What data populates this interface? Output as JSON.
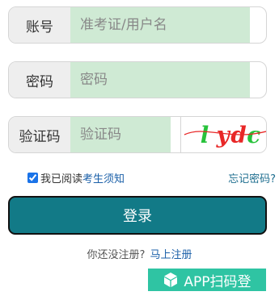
{
  "account": {
    "label": "账号",
    "placeholder": "准考证/用户名"
  },
  "password": {
    "label": "密码",
    "placeholder": "密码"
  },
  "captcha": {
    "label": "验证码",
    "placeholder": "验证码",
    "image_text": "lydc"
  },
  "agree": {
    "checked": true,
    "prefix": "我已阅读",
    "link": "考生须知"
  },
  "forgot_label": "忘记密码?",
  "login_label": "登录",
  "register": {
    "prompt": "你还没注册?",
    "link": "马上注册"
  },
  "app_scan_label": "APP扫码登",
  "colors": {
    "input_bg": "#cfead4",
    "login_button": "#127a87",
    "app_button": "#2fc4a3",
    "captcha_red": "#e82727",
    "captcha_green": "#27c23a"
  }
}
